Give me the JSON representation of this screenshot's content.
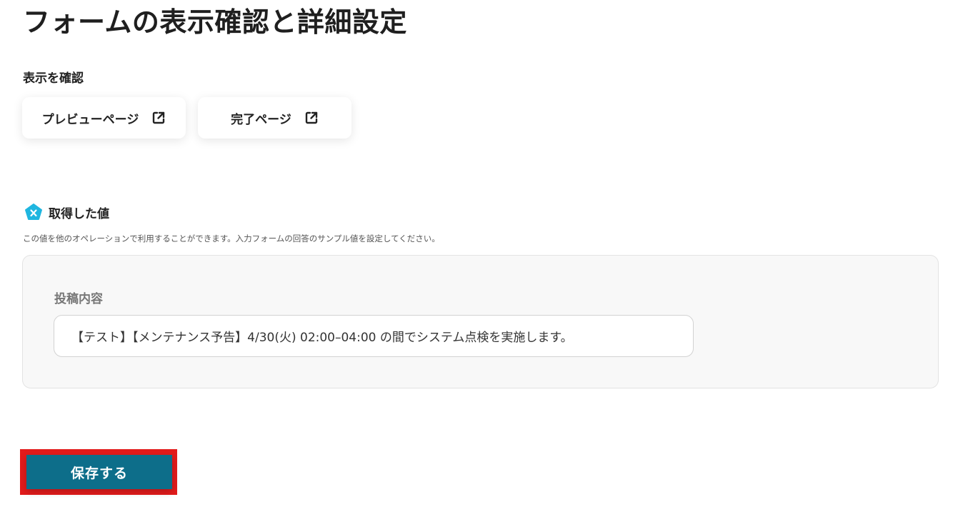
{
  "page": {
    "title": "フォームの表示確認と詳細設定"
  },
  "display_check": {
    "label": "表示を確認",
    "preview_button": {
      "label": "プレビューページ",
      "icon": "external-link-icon"
    },
    "complete_button": {
      "label": "完了ページ",
      "icon": "external-link-icon"
    }
  },
  "acquired_values": {
    "title": "取得した値",
    "icon": "x-badge-icon",
    "icon_color": "#1fb6e0",
    "description": "この値を他のオペレーションで利用することができます。入力フォームの回答のサンプル値を設定してください。",
    "fields": [
      {
        "label": "投稿内容",
        "value": "【テスト】【メンテナンス予告】4/30(火) 02:00–04:00 の間でシステム点検を実施します。"
      }
    ]
  },
  "actions": {
    "save_label": "保存する",
    "save_color": "#0d6e8a",
    "highlight_color": "#e31b1b"
  }
}
